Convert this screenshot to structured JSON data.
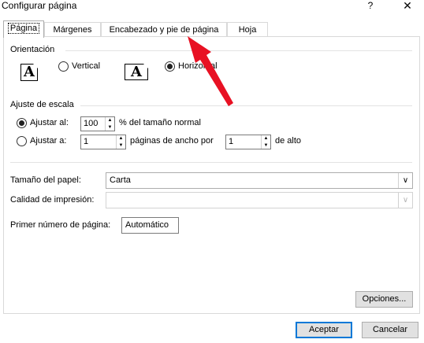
{
  "title": "Configurar página",
  "help_label": "?",
  "close_label": "✕",
  "tabs": [
    {
      "label": "Página"
    },
    {
      "label": "Márgenes"
    },
    {
      "label": "Encabezado y pie de página"
    },
    {
      "label": "Hoja"
    }
  ],
  "orientation": {
    "heading": "Orientación",
    "icon_letter": "A",
    "vertical_label": "Vertical",
    "horizontal_label": "Horizontal",
    "selected": "Horizontal"
  },
  "scaling": {
    "heading": "Ajuste de escala",
    "adjust_to_label": "Ajustar al:",
    "adjust_to_value": "100",
    "adjust_to_suffix": "% del tamaño normal",
    "fit_to_label": "Ajustar a:",
    "fit_wide_value": "1",
    "fit_wide_suffix": "páginas de ancho por",
    "fit_tall_value": "1",
    "fit_tall_suffix": "de alto",
    "selected": "Ajustar al:"
  },
  "paper_size": {
    "label": "Tamaño del papel:",
    "value": "Carta"
  },
  "print_quality": {
    "label": "Calidad de impresión:",
    "value": ""
  },
  "first_page_number": {
    "label": "Primer número de página:",
    "value": "Automático"
  },
  "buttons": {
    "options": "Opciones...",
    "ok": "Aceptar",
    "cancel": "Cancelar"
  },
  "spinner_up": "▲",
  "spinner_down": "▼",
  "dropdown_arrow": "∨",
  "annotation_arrow_color": "#e81123"
}
